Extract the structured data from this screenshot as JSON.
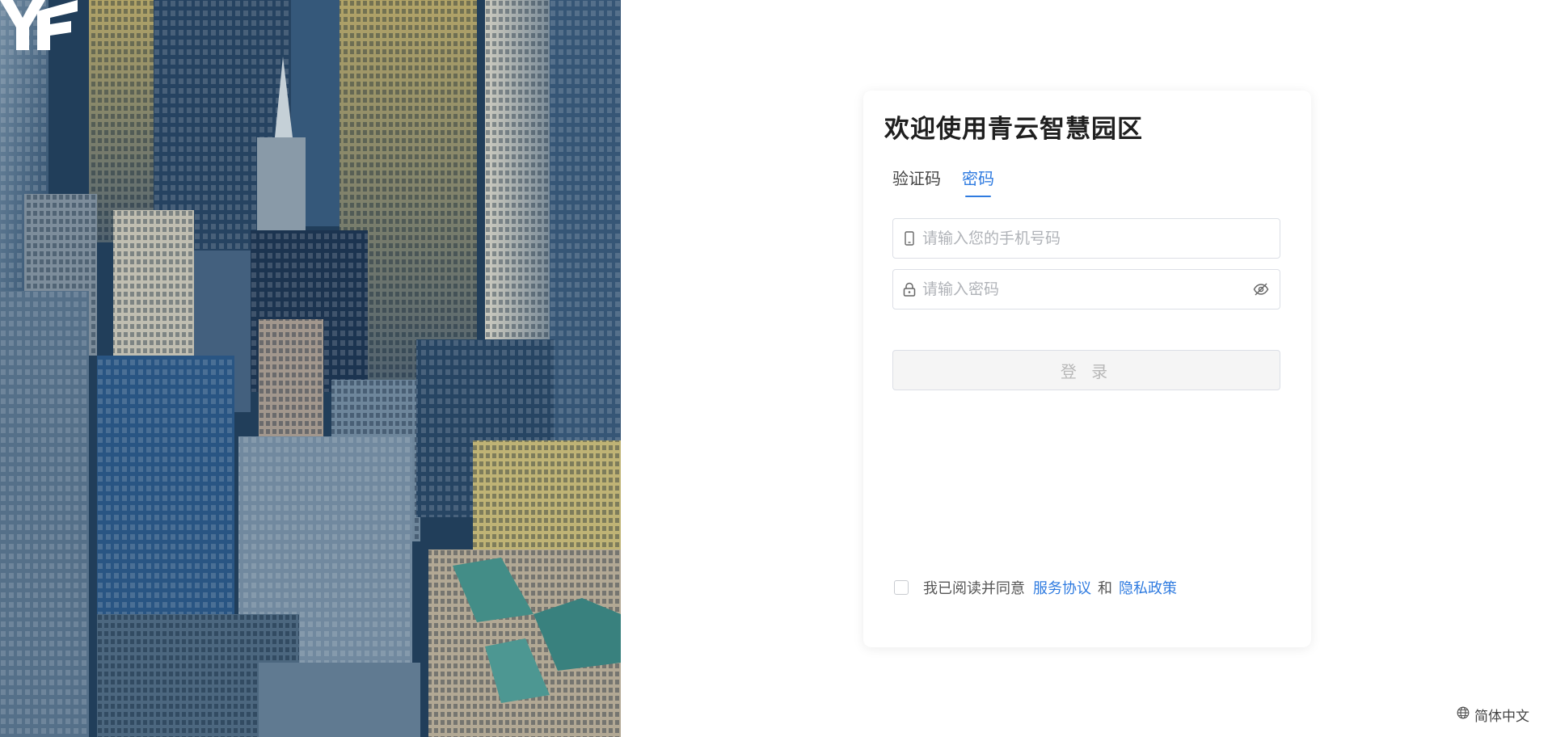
{
  "brand": {
    "logo_text": "YF"
  },
  "login": {
    "title": "欢迎使用青云智慧园区",
    "tabs": [
      {
        "label": "验证码",
        "active": false
      },
      {
        "label": "密码",
        "active": true
      }
    ],
    "phone_placeholder": "请输入您的手机号码",
    "password_placeholder": "请输入密码",
    "submit_label": "登 录",
    "agreement": {
      "prefix": "我已阅读并同意",
      "service_link": "服务协议",
      "and": "和",
      "privacy_link": "隐私政策",
      "checked": false
    }
  },
  "footer": {
    "language": "简体中文"
  },
  "colors": {
    "accent": "#2f7be0",
    "button_disabled_bg": "#f5f5f5",
    "border": "#dcdfe6"
  },
  "icons": [
    "mobile-phone-icon",
    "lock-icon",
    "eye-hidden-icon",
    "globe-icon"
  ]
}
